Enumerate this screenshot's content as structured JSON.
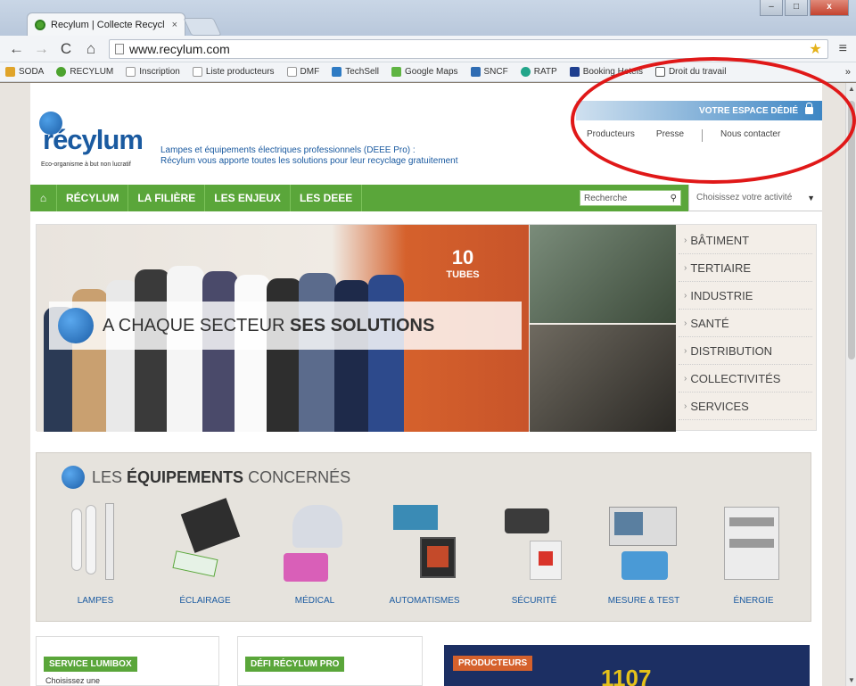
{
  "browser": {
    "tab_title": "Recylum | Collecte Recycl",
    "tab_close": "×",
    "url": "www.recylum.com",
    "window_controls": [
      "–",
      "□",
      "x"
    ],
    "bookmarks": [
      "SODA",
      "RECYLUM",
      "Inscription",
      "Liste producteurs",
      "DMF",
      "TechSell",
      "Google Maps",
      "SNCF",
      "RATP",
      "Booking Hotels",
      "Droit du travail"
    ],
    "bookmarks_more": "»"
  },
  "header": {
    "logo": "récylum",
    "logo_tagline": "Eco-organisme à but non lucratif",
    "desc_line1": "Lampes et équipements électriques professionnels (DEEE Pro) :",
    "desc_line2": "Récylum vous apporte toutes les solutions pour leur recyclage gratuitement",
    "espace_label": "VOTRE ESPACE DÉDIÉ",
    "links": [
      "Producteurs",
      "Presse",
      "Nous contacter"
    ]
  },
  "nav": {
    "items": [
      "RÉCYLUM",
      "LA FILIÈRE",
      "LES ENJEUX",
      "LES DEEE"
    ],
    "search_placeholder": "Recherche",
    "activity": "Choisissez votre activité"
  },
  "hero": {
    "banner_pre": "A CHAQUE SECTEUR ",
    "banner_bold": "SES SOLUTIONS",
    "tubes_num": "10",
    "tubes_label": "TUBES",
    "sectors": [
      "BÂTIMENT",
      "TERTIAIRE",
      "INDUSTRIE",
      "SANTÉ",
      "DISTRIBUTION",
      "COLLECTIVITÉS",
      "SERVICES"
    ]
  },
  "equipements": {
    "title_pre": "LES ",
    "title_bold": "ÉQUIPEMENTS",
    "title_post": " CONCERNÉS",
    "items": [
      "LAMPES",
      "ÉCLAIRAGE",
      "MÉDICAL",
      "AUTOMATISMES",
      "SÉCURITÉ",
      "MESURE & TEST",
      "ÉNERGIE"
    ]
  },
  "bottom": {
    "service_label": "SERVICE LUMIBOX",
    "service_sub": "Choisissez une",
    "defi_label": "DÉFI RÉCYLUM PRO",
    "producteurs_label": "PRODUCTEURS",
    "producteurs_num": "1107"
  },
  "colors": {
    "brand_green": "#5aa63a",
    "brand_blue": "#1a5aa0",
    "annotation_red": "#e01818"
  }
}
